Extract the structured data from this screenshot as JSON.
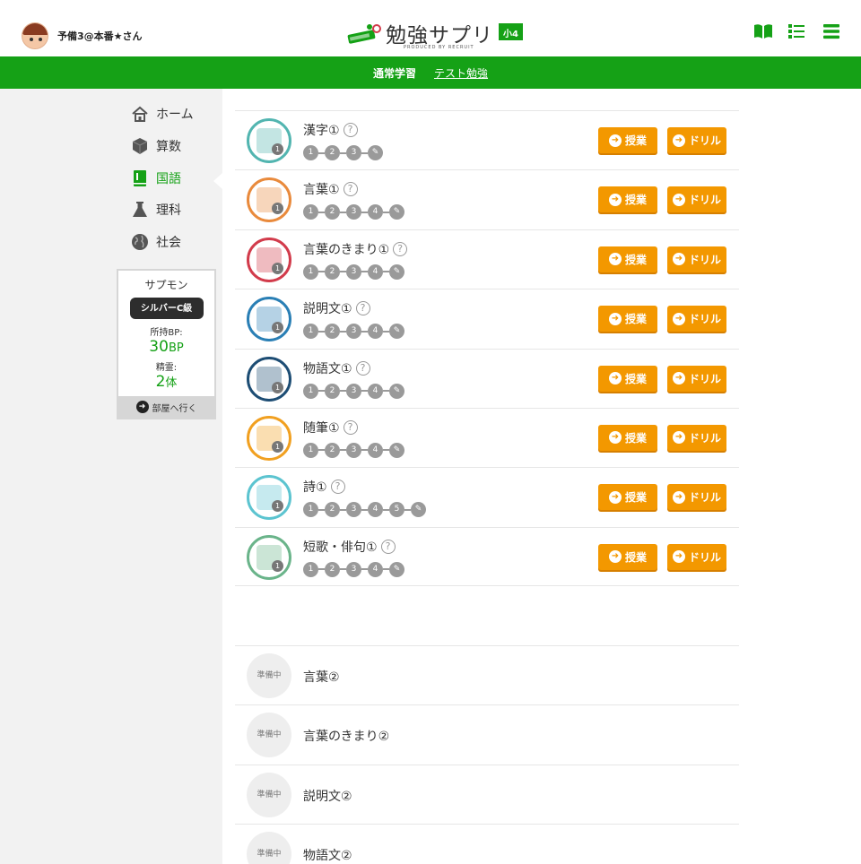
{
  "user": {
    "name": "予備3@本番★さん"
  },
  "logo": {
    "text": "勉強サプリ",
    "grade": "小4",
    "sub": "PRODUCED BY RECRUIT"
  },
  "nav": {
    "regular": "通常学習",
    "test": "テスト勉強"
  },
  "sidebar": {
    "items": [
      {
        "label": "ホーム",
        "icon": "home-icon"
      },
      {
        "label": "算数",
        "icon": "cube-icon"
      },
      {
        "label": "国語",
        "icon": "book-icon",
        "active": true
      },
      {
        "label": "理科",
        "icon": "flask-icon"
      },
      {
        "label": "社会",
        "icon": "globe-icon"
      }
    ]
  },
  "sapmon": {
    "title": "サプモン",
    "badge": "シルバーC級",
    "bp_label": "所持BP:",
    "bp_value": "30",
    "bp_unit": "BP",
    "spirit_label": "精霊:",
    "spirit_value": "2",
    "spirit_unit": "体",
    "go_label": "部屋へ行く"
  },
  "buttons": {
    "lesson": "授業",
    "drill": "ドリル"
  },
  "units": [
    {
      "title": "漢字①",
      "steps": [
        "1",
        "2",
        "3"
      ],
      "color": "#52b5b0"
    },
    {
      "title": "言葉①",
      "steps": [
        "1",
        "2",
        "3",
        "4"
      ],
      "color": "#e98a3c"
    },
    {
      "title": "言葉のきまり①",
      "steps": [
        "1",
        "2",
        "3",
        "4"
      ],
      "color": "#d23b4b"
    },
    {
      "title": "説明文①",
      "steps": [
        "1",
        "2",
        "3",
        "4"
      ],
      "color": "#2a7fb5"
    },
    {
      "title": "物語文①",
      "steps": [
        "1",
        "2",
        "3",
        "4"
      ],
      "color": "#1d4d74"
    },
    {
      "title": "随筆①",
      "steps": [
        "1",
        "2",
        "3",
        "4"
      ],
      "color": "#f1a020"
    },
    {
      "title": "詩①",
      "steps": [
        "1",
        "2",
        "3",
        "4",
        "5"
      ],
      "color": "#5cc4d0"
    },
    {
      "title": "短歌・俳句①",
      "steps": [
        "1",
        "2",
        "3",
        "4"
      ],
      "color": "#6ab48a"
    }
  ],
  "upcoming": {
    "label": "準備中",
    "items": [
      "言葉②",
      "言葉のきまり②",
      "説明文②",
      "物語文②"
    ]
  },
  "colors": {
    "brand_green": "#15a116",
    "button_orange": "#f39800"
  }
}
